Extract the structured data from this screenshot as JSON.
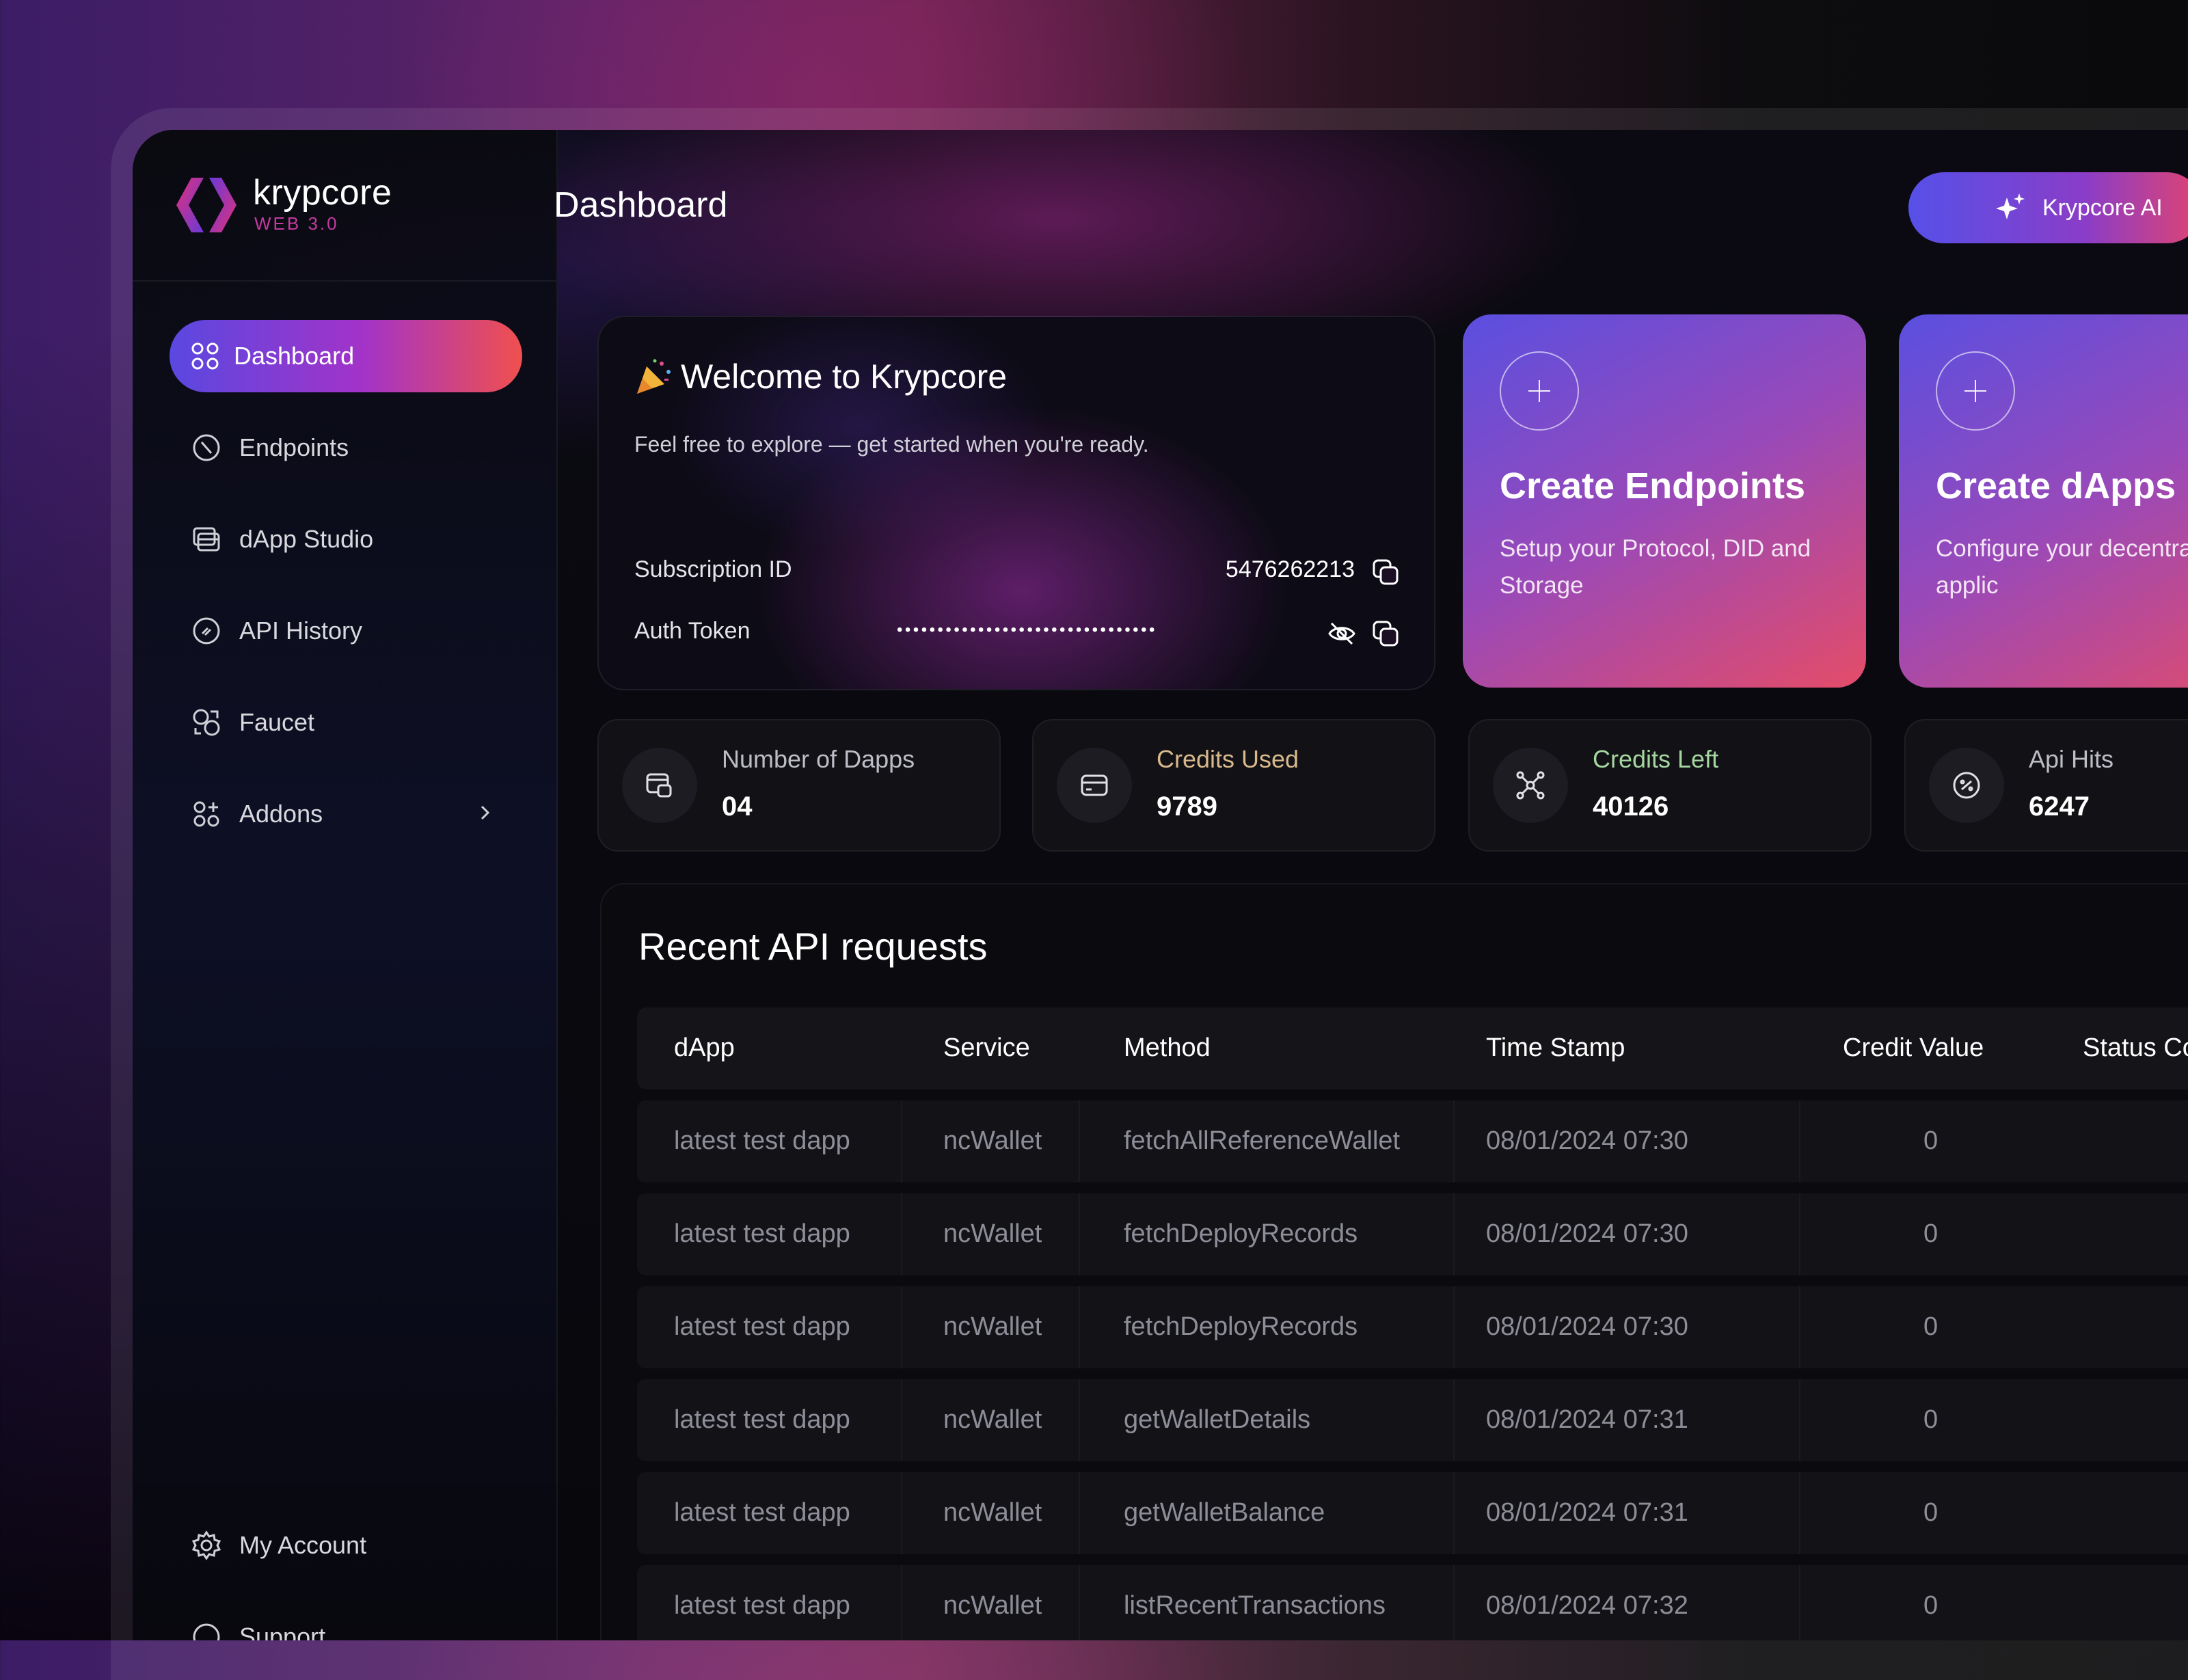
{
  "brand": {
    "name": "krypcore",
    "sub": "WEB 3.0"
  },
  "header": {
    "title": "Dashboard",
    "ai_button": "Krypcore AI"
  },
  "sidebar": {
    "items": [
      {
        "label": "Dashboard",
        "icon": "grid-icon",
        "active": true
      },
      {
        "label": "Endpoints",
        "icon": "endpoint-icon"
      },
      {
        "label": "dApp Studio",
        "icon": "studio-icon"
      },
      {
        "label": "API History",
        "icon": "history-icon"
      },
      {
        "label": "Faucet",
        "icon": "faucet-icon"
      },
      {
        "label": "Addons",
        "icon": "addons-icon"
      }
    ],
    "bottom": [
      {
        "label": "My Account",
        "icon": "gear-icon"
      },
      {
        "label": "Support",
        "icon": "support-icon"
      }
    ]
  },
  "welcome": {
    "title": "Welcome to Krypcore",
    "description": "Feel free to explore — get started when you're ready.",
    "subscription_label": "Subscription ID",
    "subscription_id": "5476262213",
    "auth_label": "Auth Token",
    "auth_token_masked": "••••••••••••••••••••••••••••••••"
  },
  "create_cards": [
    {
      "title": "Create Endpoints",
      "description": "Setup your Protocol, DID and Storage"
    },
    {
      "title": "Create dApps",
      "description": "Configure your decentralised applic"
    }
  ],
  "stats": [
    {
      "label": "Number of Dapps",
      "value": "04",
      "label_color": "#bdbdc6"
    },
    {
      "label": "Credits Used",
      "value": "9789",
      "label_color": "#d9b98c"
    },
    {
      "label": "Credits Left",
      "value": "40126",
      "label_color": "#a6d6a0"
    },
    {
      "label": "Api Hits",
      "value": "6247",
      "label_color": "#bdbdc6"
    }
  ],
  "table": {
    "title": "Recent API requests",
    "columns": [
      "dApp",
      "Service",
      "Method",
      "Time Stamp",
      "Credit Value",
      "Status Co"
    ],
    "rows": [
      [
        "latest test dapp",
        "ncWallet",
        "fetchAllReferenceWallet",
        "08/01/2024 07:30",
        "0"
      ],
      [
        "latest test dapp",
        "ncWallet",
        "fetchDeployRecords",
        "08/01/2024 07:30",
        "0"
      ],
      [
        "latest test dapp",
        "ncWallet",
        "fetchDeployRecords",
        "08/01/2024 07:30",
        "0"
      ],
      [
        "latest test dapp",
        "ncWallet",
        "getWalletDetails",
        "08/01/2024 07:31",
        "0"
      ],
      [
        "latest test dapp",
        "ncWallet",
        "getWalletBalance",
        "08/01/2024 07:31",
        "0"
      ],
      [
        "latest test dapp",
        "ncWallet",
        "listRecentTransactions",
        "08/01/2024 07:32",
        "0"
      ]
    ]
  }
}
